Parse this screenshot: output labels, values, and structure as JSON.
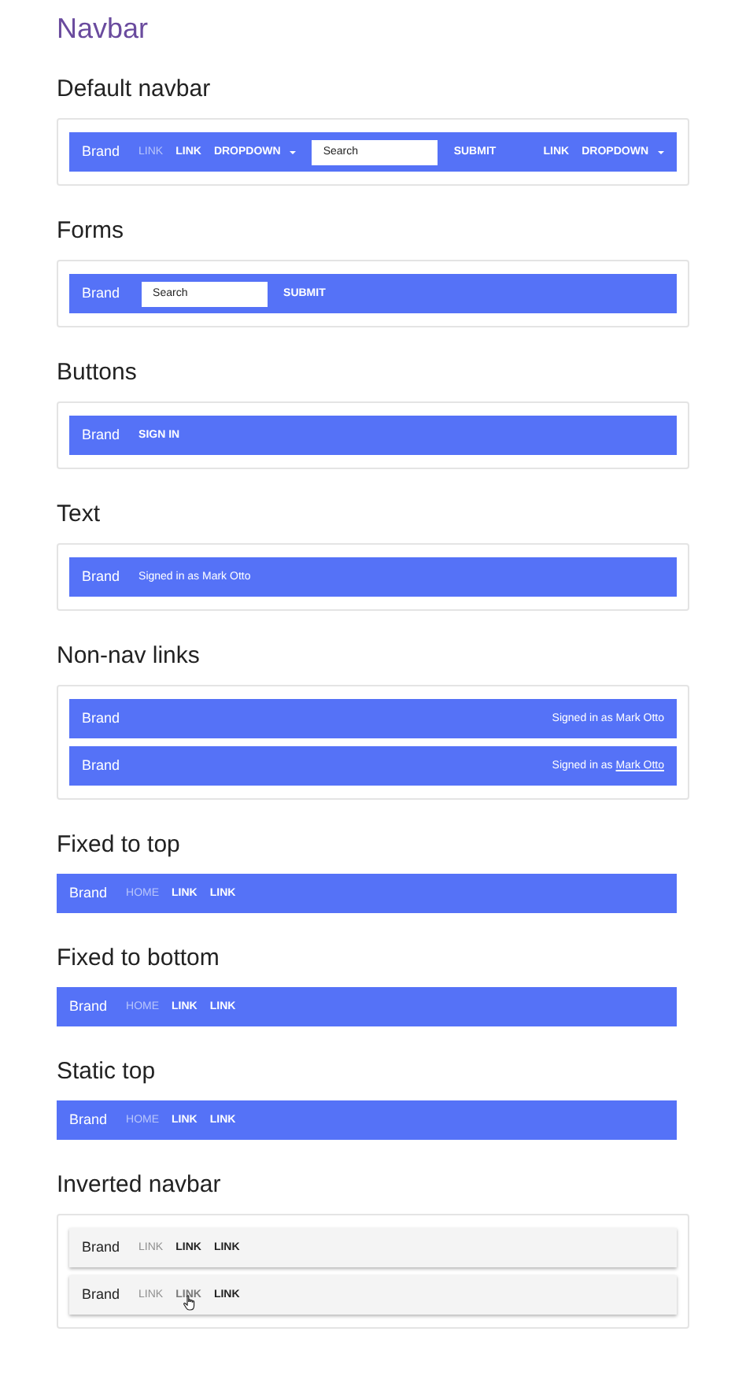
{
  "page_title": "Navbar",
  "sections": [
    {
      "title": "Default navbar",
      "framed": true,
      "navbars": [
        {
          "kind": "default",
          "items": [
            {
              "kind": "brand",
              "text": "Brand"
            },
            {
              "kind": "link",
              "text": "LINK",
              "selected": true
            },
            {
              "kind": "link",
              "text": "LINK",
              "selected": false
            },
            {
              "kind": "dropdown",
              "text": "DROPDOWN"
            },
            {
              "kind": "search",
              "placeholder": "Search"
            },
            {
              "kind": "submit",
              "text": "SUBMIT"
            },
            {
              "kind": "link",
              "text": "LINK",
              "selected": false,
              "right_aligned": true
            },
            {
              "kind": "dropdown",
              "text": "DROPDOWN"
            }
          ]
        }
      ]
    },
    {
      "title": "Forms",
      "framed": true,
      "navbars": [
        {
          "kind": "default",
          "items": [
            {
              "kind": "brand",
              "text": "Brand"
            },
            {
              "kind": "search",
              "placeholder": "Search"
            },
            {
              "kind": "submit",
              "text": "SUBMIT"
            }
          ]
        }
      ]
    },
    {
      "title": "Buttons",
      "framed": true,
      "navbars": [
        {
          "kind": "default",
          "items": [
            {
              "kind": "brand",
              "text": "Brand"
            },
            {
              "kind": "submit",
              "text": "SIGN IN"
            }
          ]
        }
      ]
    },
    {
      "title": "Text",
      "framed": true,
      "navbars": [
        {
          "kind": "default",
          "items": [
            {
              "kind": "brand",
              "text": "Brand"
            },
            {
              "kind": "text",
              "text": "Signed in as Mark Otto"
            }
          ]
        }
      ]
    },
    {
      "title": "Non-nav links",
      "framed": true,
      "navbars": [
        {
          "kind": "default",
          "items": [
            {
              "kind": "brand",
              "text": "Brand"
            },
            {
              "kind": "text",
              "text": "Signed in as Mark Otto",
              "right_aligned": true
            }
          ]
        },
        {
          "kind": "default",
          "items": [
            {
              "kind": "brand",
              "text": "Brand"
            },
            {
              "kind": "text",
              "text": "Signed in as",
              "link": "Mark Otto",
              "right_aligned": true
            }
          ]
        }
      ]
    },
    {
      "title": "Fixed to top",
      "framed": false,
      "navbars": [
        {
          "kind": "default",
          "items": [
            {
              "kind": "brand",
              "text": "Brand"
            },
            {
              "kind": "link",
              "text": "HOME",
              "selected": true
            },
            {
              "kind": "link",
              "text": "LINK",
              "selected": false
            },
            {
              "kind": "link",
              "text": "LINK",
              "selected": false
            }
          ]
        }
      ]
    },
    {
      "title": "Fixed to bottom",
      "framed": false,
      "navbars": [
        {
          "kind": "default",
          "items": [
            {
              "kind": "brand",
              "text": "Brand"
            },
            {
              "kind": "link",
              "text": "HOME",
              "selected": true
            },
            {
              "kind": "link",
              "text": "LINK",
              "selected": false
            },
            {
              "kind": "link",
              "text": "LINK",
              "selected": false
            }
          ]
        }
      ]
    },
    {
      "title": "Static top",
      "framed": false,
      "navbars": [
        {
          "kind": "default",
          "items": [
            {
              "kind": "brand",
              "text": "Brand"
            },
            {
              "kind": "link",
              "text": "HOME",
              "selected": true
            },
            {
              "kind": "link",
              "text": "LINK",
              "selected": false
            },
            {
              "kind": "link",
              "text": "LINK",
              "selected": false
            }
          ]
        }
      ]
    },
    {
      "title": "Inverted navbar",
      "framed": true,
      "navbars": [
        {
          "kind": "inverted",
          "items": [
            {
              "kind": "brand",
              "text": "Brand"
            },
            {
              "kind": "link",
              "text": "LINK",
              "selected": true,
              "hovered": false
            },
            {
              "kind": "link",
              "text": "LINK",
              "selected": false,
              "hovered": false
            },
            {
              "kind": "link",
              "text": "LINK",
              "selected": false,
              "hovered": false
            }
          ]
        },
        {
          "kind": "inverted",
          "items": [
            {
              "kind": "brand",
              "text": "Brand"
            },
            {
              "kind": "link",
              "text": "LINK",
              "selected": true,
              "hovered": false
            },
            {
              "kind": "link",
              "text": "LINK",
              "selected": false,
              "hovered": true
            },
            {
              "kind": "link",
              "text": "LINK",
              "selected": false,
              "hovered": false
            }
          ]
        }
      ]
    }
  ]
}
